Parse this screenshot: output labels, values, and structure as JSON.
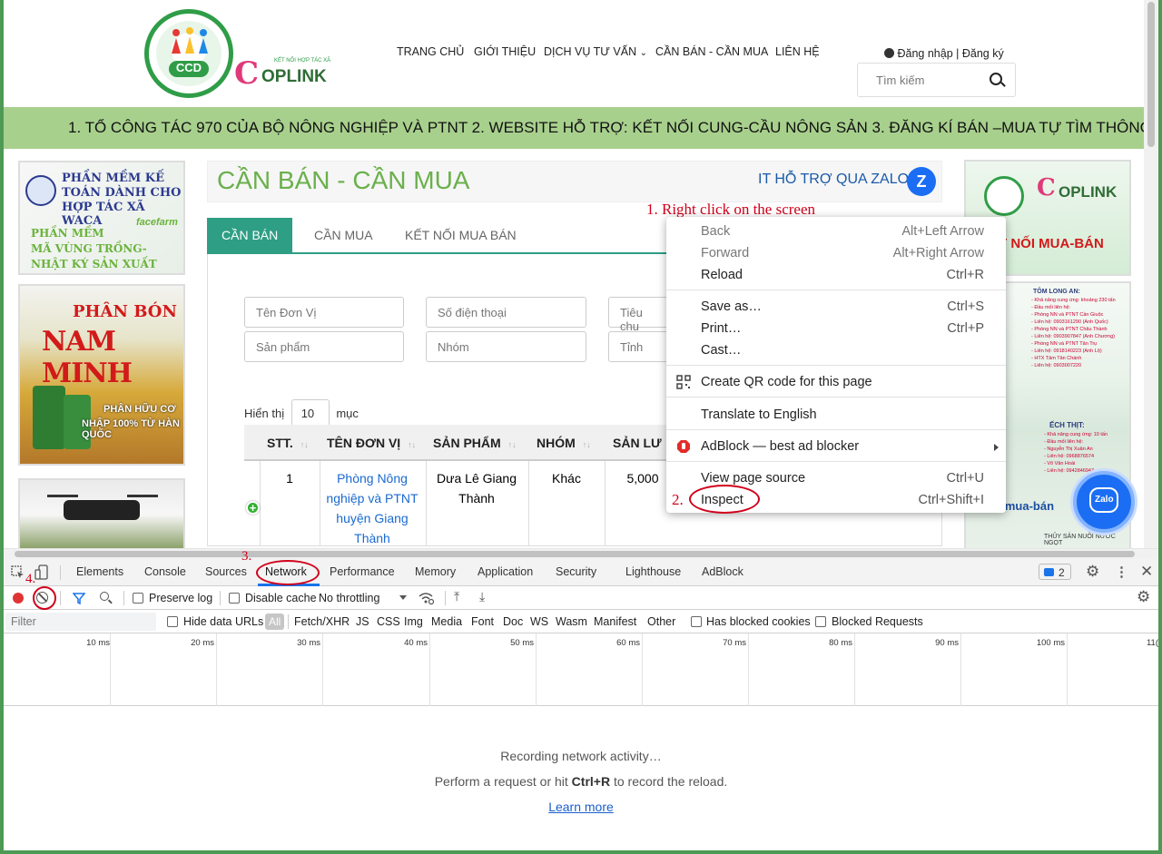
{
  "header": {
    "ccd_logo_text": "CCD",
    "coplink": {
      "c": "C",
      "name": "OPLINK",
      "small": "KẾT NỐI HỢP TÁC XÃ"
    },
    "nav": [
      "TRANG CHỦ",
      "GIỚI THIỆU",
      "DỊCH VỤ TƯ VẤN",
      "CẦN BÁN - CẦN MUA",
      "LIÊN HỆ"
    ],
    "login": "Đăng nhập",
    "register": "Đăng ký",
    "search_placeholder": "Tìm kiếm"
  },
  "marquee": "1. TỔ CÔNG TÁC 970 CỦA BỘ NÔNG NGHIỆP VÀ PTNT 2. WEBSITE HỖ TRỢ: KẾT NỐI CUNG-CẦU NÔNG SẢN 3. ĐĂNG KÍ BÁN –MUA TỰ TÌM THÔNG TIN NGƯ",
  "ads_left": {
    "ad1": {
      "l1": "PHẦN MỀM KẾ",
      "l2": "TOÁN DÀNH CHO",
      "l3": "HỢP TÁC XÃ WACA",
      "l4a": "PHẦN MỀM",
      "l4b": "MÃ VÙNG TRỒNG-",
      "l4c": "NHẬT KÝ SẢN XUẤT",
      "brand": "facefarm"
    },
    "ad2": {
      "p1": "PHÂN BÓN",
      "p2": "NAM MINH",
      "p3": "PHÂN HỮU CƠ",
      "p4": "NHẬP 100% TỪ HÀN QUỐC"
    }
  },
  "ads_right": {
    "kn": "T NỐI MUA-BÁN",
    "tl": "TÔM LONG AN:",
    "lines": [
      "- Khả năng cung ứng: khoảng 230 tấn",
      "- Đầu mối liên hệ:",
      "- Phòng NN và PTNT Cần Giuộc",
      "- Liên hệ: 0903161290 (Anh Quốc)",
      "- Phòng NN và PTNT Châu Thành",
      "- Liên hệ: 0903907847 (Anh Chương)",
      "- Phòng NN và PTNT Tân Trụ",
      "- Liên hệ: 0918140223 (Anh Lộ)",
      "- HTX Tâm Tân Chánh",
      "- Liên hệ: 0903007220"
    ],
    "ec": "ẾCH THỊT:",
    "ec_lines": [
      "- Khả năng cung ứng: 10 tấn",
      "- Đầu mối liên hệ:",
      "- Nguyễn Thị Xuân An",
      "- Liên hệ: 0968876574",
      "- Võ Văn Hoài",
      "- Liên hệ: 0942846947"
    ],
    "mb": "ợ mua-bán",
    "ts": "THỦY SẢN NUÔI NƯỚC NGỌT",
    "zalo": "Zalo"
  },
  "section": {
    "title": "CẦN BÁN - CẦN MUA",
    "zalo_text": "IT HỖ TRỢ QUA ZALO",
    "zalo_icon": "Z"
  },
  "tabs": [
    "CẦN BÁN",
    "CẦN MUA",
    "KẾT NỐI MUA BÁN"
  ],
  "filters": {
    "don_vi": "Tên Đơn Vị",
    "sdt": "Số điện thoại",
    "tieu_chuan": "Tiêu chu",
    "san_pham": "Sản phẩm",
    "nhom": "Nhóm",
    "tinh": "Tỉnh"
  },
  "page_size": {
    "prefix": "Hiển thị",
    "value": "10",
    "suffix": "mục"
  },
  "table": {
    "headers": [
      "STT.",
      "TÊN ĐƠN VỊ",
      "SẢN PHẨM",
      "NHÓM",
      "SẢN LƯ"
    ],
    "row": {
      "stt": "1",
      "don_vi": "Phòng Nông nghiệp và PTNT huyện Giang Thành",
      "san_pham": "Dưa Lê Giang Thành",
      "nhom": "Khác",
      "san_luong": "5,000"
    }
  },
  "annotations": {
    "a1": "1. Right click on the screen",
    "a2": "2.",
    "a3": "3.",
    "a4": "4."
  },
  "context_menu": [
    {
      "label": "Back",
      "shortcut": "Alt+Left Arrow",
      "disabled": true
    },
    {
      "label": "Forward",
      "shortcut": "Alt+Right Arrow",
      "disabled": true
    },
    {
      "label": "Reload",
      "shortcut": "Ctrl+R"
    },
    {
      "label": "Save as…",
      "shortcut": "Ctrl+S"
    },
    {
      "label": "Print…",
      "shortcut": "Ctrl+P"
    },
    {
      "label": "Cast…",
      "shortcut": ""
    },
    {
      "label": "Create QR code for this page",
      "shortcut": "",
      "icon": "qr-code-icon"
    },
    {
      "label": "Translate to English",
      "shortcut": ""
    },
    {
      "label": "AdBlock — best ad blocker",
      "shortcut": "",
      "icon": "adblock-icon",
      "submenu": true
    },
    {
      "label": "View page source",
      "shortcut": "Ctrl+U"
    },
    {
      "label": "Inspect",
      "shortcut": "Ctrl+Shift+I"
    }
  ],
  "devtools": {
    "tabs": [
      "Elements",
      "Console",
      "Sources",
      "Network",
      "Performance",
      "Memory",
      "Application",
      "Security",
      "Lighthouse",
      "AdBlock"
    ],
    "selected_tab": "Network",
    "issues_count": "2",
    "preserve_log": "Preserve log",
    "disable_cache": "Disable cache",
    "throttling": "No throttling",
    "filter_placeholder": "Filter",
    "hide_data_urls": "Hide data URLs",
    "types": [
      "All",
      "Fetch/XHR",
      "JS",
      "CSS",
      "Img",
      "Media",
      "Font",
      "Doc",
      "WS",
      "Wasm",
      "Manifest",
      "Other"
    ],
    "blocked_cookies": "Has blocked cookies",
    "blocked_requests": "Blocked Requests",
    "timeline": [
      "10 ms",
      "20 ms",
      "30 ms",
      "40 ms",
      "50 ms",
      "60 ms",
      "70 ms",
      "80 ms",
      "90 ms",
      "100 ms",
      "11("
    ],
    "recording": "Recording network activity…",
    "hint_prefix": "Perform a request or hit",
    "hint_key": "Ctrl+R",
    "hint_suffix": "to record the reload.",
    "learn_more": "Learn more"
  },
  "colors": {
    "brand_green": "#2f9d47",
    "teal": "#2e9e84",
    "marquee": "#a8d08d",
    "annotation_red": "#d0021b",
    "devtools_blue": "#1a73e8"
  }
}
